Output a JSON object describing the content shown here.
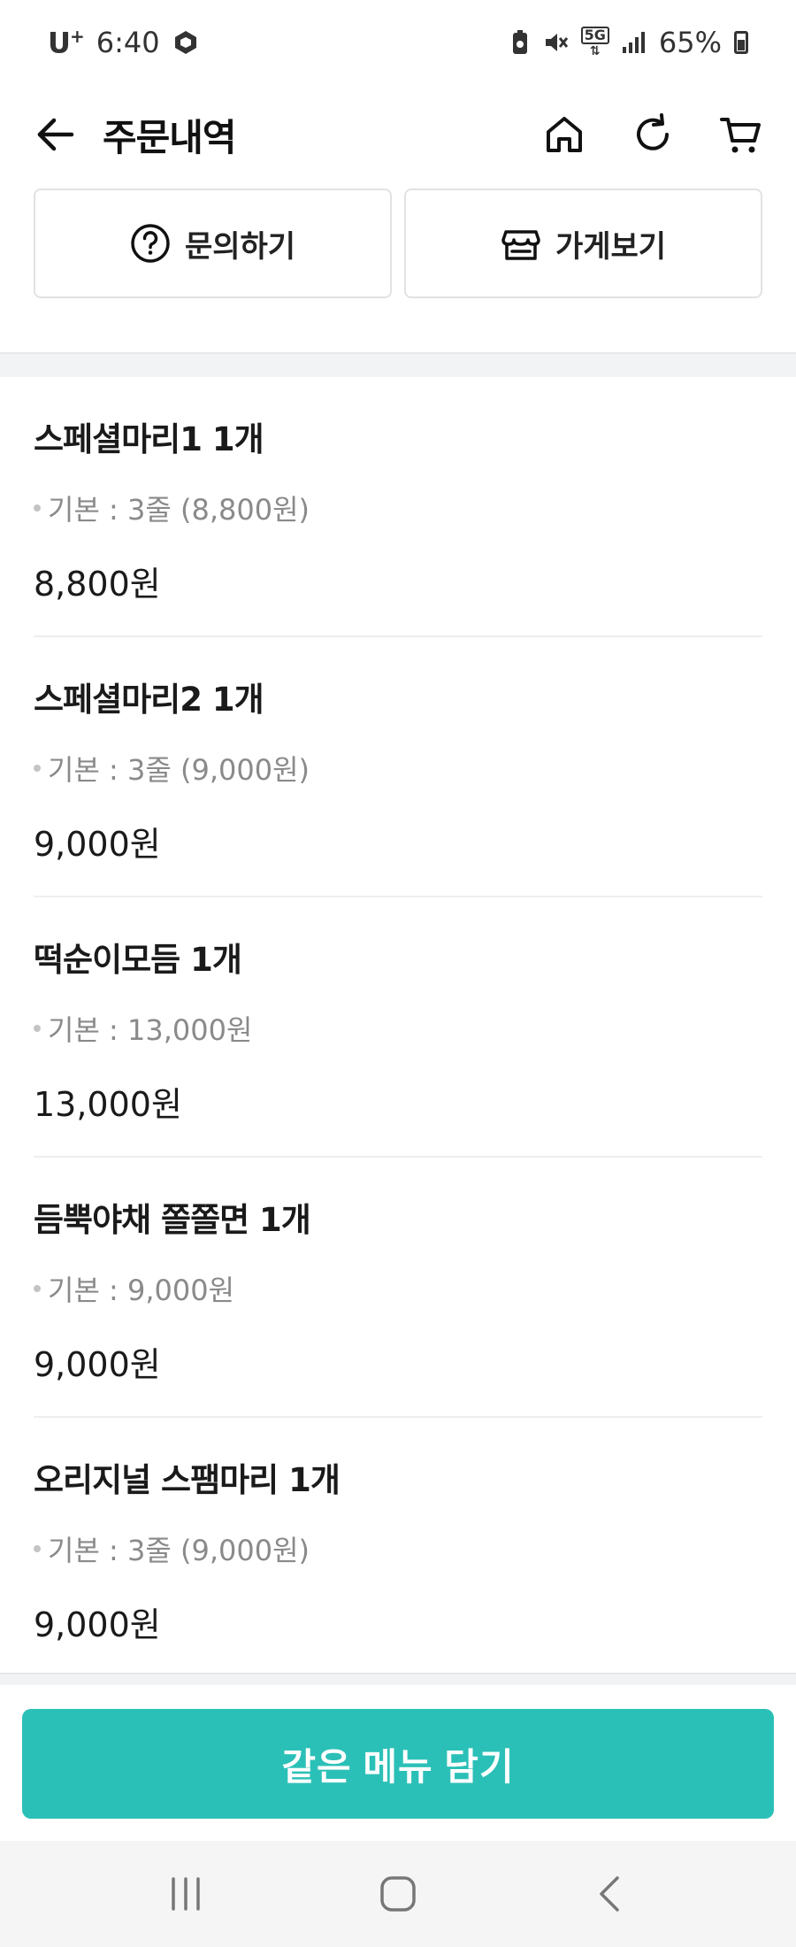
{
  "status_bar": {
    "carrier": "U",
    "carrier_sup": "+",
    "time": "6:40",
    "network": "5G",
    "battery": "65%"
  },
  "header": {
    "title": "주문내역"
  },
  "actions": {
    "inquiry_label": "문의하기",
    "store_label": "가게보기"
  },
  "order_items": [
    {
      "name": "스페셜마리1 1개",
      "option": "기본 : 3줄 (8,800원)",
      "price": "8,800원"
    },
    {
      "name": "스페셜마리2 1개",
      "option": "기본 : 3줄 (9,000원)",
      "price": "9,000원"
    },
    {
      "name": "떡순이모듬 1개",
      "option": "기본 : 13,000원",
      "price": "13,000원"
    },
    {
      "name": "듬뿍야채 쫄쫄면 1개",
      "option": "기본 : 9,000원",
      "price": "9,000원"
    },
    {
      "name": "오리지널 스팸마리 1개",
      "option": "기본 : 3줄 (9,000원)",
      "price": "9,000원"
    }
  ],
  "cta": {
    "label": "같은 메뉴 담기"
  },
  "colors": {
    "accent": "#2bc0b7",
    "text_primary": "#111111",
    "text_secondary": "#8a8a8a"
  },
  "icons": {
    "back": "arrow-left-icon",
    "home": "home-icon",
    "refresh": "refresh-icon",
    "cart": "cart-icon",
    "inquiry": "question-circle-icon",
    "store": "store-icon"
  }
}
